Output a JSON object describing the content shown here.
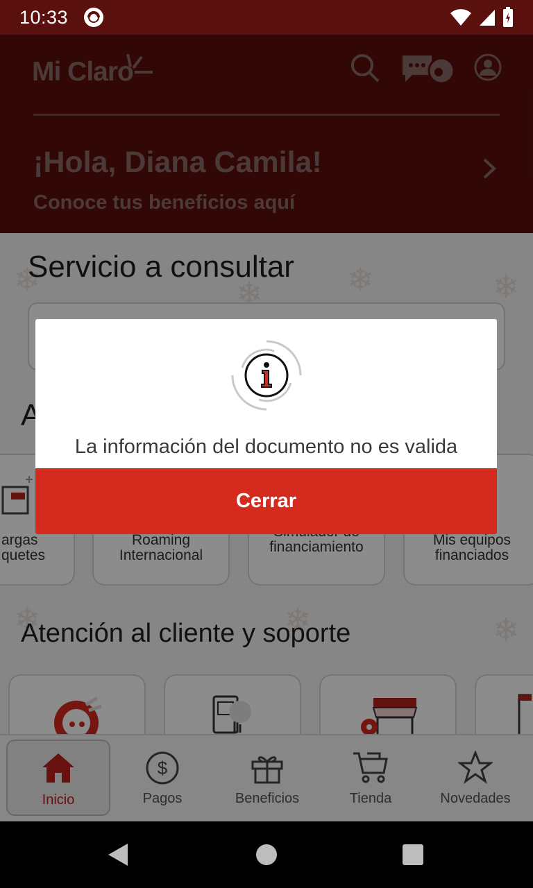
{
  "status_bar": {
    "time": "10:33"
  },
  "header": {
    "logo": "Mi Claro",
    "greeting": "¡Hola, Diana Camila!",
    "greeting_sub": "Conoce tus beneficios aquí"
  },
  "main": {
    "service_title": "Servicio a consultar",
    "section_letter": "A",
    "cards": [
      {
        "label_line1": "argas",
        "label_line2": "quetes"
      },
      {
        "label_line1": "Roaming",
        "label_line2": "Internacional"
      },
      {
        "label_line1": "Simulador de",
        "label_line2": "financiamiento"
      },
      {
        "label_line1": "Mis equipos",
        "label_line2": "financiados"
      }
    ],
    "support_title": "Atención al cliente y soporte"
  },
  "bottom_nav": {
    "items": [
      {
        "label": "Inicio",
        "icon": "home-icon"
      },
      {
        "label": "Pagos",
        "icon": "dollar-icon"
      },
      {
        "label": "Beneficios",
        "icon": "gift-icon"
      },
      {
        "label": "Tienda",
        "icon": "cart-icon"
      },
      {
        "label": "Novedades",
        "icon": "star-icon"
      }
    ]
  },
  "dialog": {
    "message": "La información del documento no es valida",
    "button_label": "Cerrar",
    "icon": "info-icon"
  },
  "colors": {
    "brand_red": "#d52b1e",
    "header_bg": "#5a100c"
  }
}
